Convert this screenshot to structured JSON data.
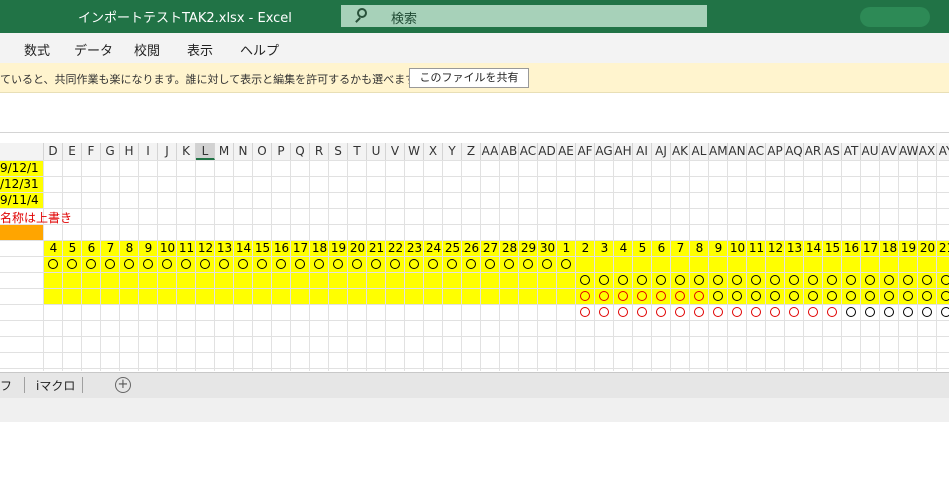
{
  "titlebar": {
    "title": "インポートテストTAK2.xlsx  -  Excel",
    "search_label": "検索",
    "search_icon": "search-icon"
  },
  "ribbon": {
    "items": [
      "数式",
      "データ",
      "校閲",
      "表示",
      "ヘルプ"
    ]
  },
  "infobar": {
    "message": "ていると、共同作業も楽になります。誰に対して表示と編集を許可するかも選べます。",
    "share_button": "このファイルを共有"
  },
  "grid": {
    "column_headers": [
      "D",
      "E",
      "F",
      "G",
      "H",
      "I",
      "J",
      "K",
      "L",
      "M",
      "N",
      "O",
      "P",
      "Q",
      "R",
      "S",
      "T",
      "U",
      "V",
      "W",
      "X",
      "Y",
      "Z",
      "AA",
      "AB",
      "AC",
      "AD",
      "AE",
      "AF",
      "AG",
      "AH",
      "AI",
      "AJ",
      "AK",
      "AL",
      "AM",
      "AN",
      "AC",
      "AP",
      "AQ",
      "AR",
      "AS",
      "AT",
      "AU",
      "AV",
      "AW",
      "AX",
      "AY"
    ],
    "selected_column": "L",
    "left_cells": [
      "9/12/1",
      "/12/31",
      "9/11/4",
      "名称は上書き"
    ],
    "day_numbers": [
      "4",
      "5",
      "6",
      "7",
      "8",
      "9",
      "10",
      "11",
      "12",
      "13",
      "14",
      "15",
      "16",
      "17",
      "18",
      "19",
      "20",
      "21",
      "22",
      "23",
      "24",
      "25",
      "26",
      "27",
      "28",
      "29",
      "30",
      "1",
      "2",
      "3",
      "4",
      "5",
      "6",
      "7",
      "8",
      "9",
      "10",
      "11",
      "12",
      "13",
      "14",
      "15",
      "16",
      "17",
      "18",
      "19",
      "20",
      "21"
    ],
    "colors": {
      "yellow": "#ffff00",
      "orange": "#ffa500",
      "red_text": "#e00000",
      "header_selected_underline": "#217346"
    },
    "circle_rows": [
      {
        "start_index": 0,
        "end_index": 27,
        "red_indices": []
      },
      {
        "start_index": 28,
        "end_index": 47,
        "red_indices": []
      },
      {
        "start_index": 28,
        "end_index": 47,
        "red_indices": [
          28,
          29,
          30,
          31,
          32,
          33,
          34
        ]
      },
      {
        "start_index": 28,
        "end_index": 47,
        "red_indices": [
          28,
          29,
          30,
          31,
          32,
          33,
          34,
          35,
          36,
          37,
          38,
          39,
          40,
          41
        ]
      }
    ]
  },
  "sheets": {
    "tabs": [
      "フ",
      "iマクロ"
    ],
    "add_icon": "plus-circle-icon"
  }
}
